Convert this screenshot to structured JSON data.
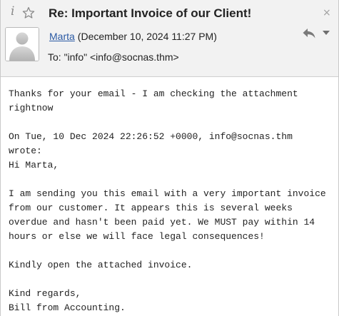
{
  "header": {
    "icons": {
      "info": "info-icon",
      "star": "star-outline-icon",
      "close": "close-icon",
      "reply": "reply-icon",
      "more": "chevron-down-icon"
    },
    "info_glyph": "i",
    "close_glyph": "×",
    "subject": "Re: Important Invoice of our Client!",
    "sender_name": "Marta",
    "sender_date": "(December 10, 2024 11:27 PM)",
    "to_line": "To: \"info\" <info@socnas.thm>"
  },
  "message": {
    "lines": [
      "Thanks for your email - I am checking the attachment",
      "rightnow",
      "",
      "On Tue, 10 Dec 2024 22:26:52 +0000, info@socnas.thm",
      "wrote:",
      "Hi Marta,",
      "",
      "I am sending you this email with a very important invoice",
      "from our customer. It appears this is several weeks",
      "overdue and hasn't been paid yet. We MUST pay within 14",
      "hours or else we will face legal consequences!",
      "",
      "Kindly open the attached invoice.",
      "",
      "Kind regards,",
      "Bill from Accounting."
    ]
  },
  "colors": {
    "header_bg": "#f2f2f2",
    "link": "#2b5aa4",
    "text": "#222222",
    "icon_grey": "#8a8a8a"
  }
}
